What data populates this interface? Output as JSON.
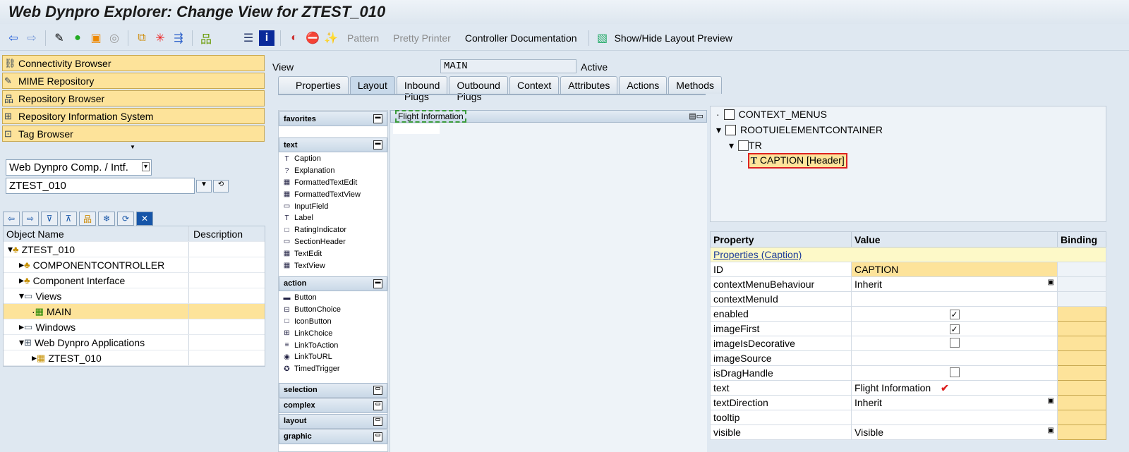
{
  "title": "Web Dynpro Explorer: Change View for ZTEST_010",
  "toolbar": {
    "pattern": "Pattern",
    "pretty_printer": "Pretty Printer",
    "controller_doc": "Controller Documentation",
    "show_hide": "Show/Hide Layout Preview"
  },
  "nav": [
    "Connectivity Browser",
    "MIME Repository",
    "Repository Browser",
    "Repository Information System",
    "Tag Browser"
  ],
  "object_type": "Web Dynpro Comp. / Intf.",
  "object_name": "ZTEST_010",
  "tree": {
    "col_name": "Object Name",
    "col_desc": "Description",
    "rows": [
      "ZTEST_010",
      "COMPONENTCONTROLLER",
      "Component Interface",
      "Views",
      "MAIN",
      "Windows",
      "Web Dynpro Applications",
      "ZTEST_010"
    ]
  },
  "view": {
    "label": "View",
    "name": "MAIN",
    "status": "Active"
  },
  "tabs": [
    "Properties",
    "Layout",
    "Inbound Plugs",
    "Outbound Plugs",
    "Context",
    "Attributes",
    "Actions",
    "Methods"
  ],
  "palette": {
    "favorites": "favorites",
    "text": "text",
    "text_items": [
      "Caption",
      "Explanation",
      "FormattedTextEdit",
      "FormattedTextView",
      "InputField",
      "Label",
      "RatingIndicator",
      "SectionHeader",
      "TextEdit",
      "TextView"
    ],
    "action": "action",
    "action_items": [
      "Button",
      "ButtonChoice",
      "IconButton",
      "LinkChoice",
      "LinkToAction",
      "LinkToURL",
      "TimedTrigger"
    ],
    "selection": "selection",
    "complex": "complex",
    "layout": "layout",
    "graphic": "graphic"
  },
  "canvas_caption": "Flight Information",
  "ui_tree": {
    "context_menus": "CONTEXT_MENUS",
    "root": "ROOTUIELEMENTCONTAINER",
    "tr": "TR",
    "caption": "CAPTION",
    "caption_role": "[Header]"
  },
  "props": {
    "h_property": "Property",
    "h_value": "Value",
    "h_binding": "Binding",
    "section": "Properties (Caption)",
    "rows": [
      {
        "p": "ID",
        "v": "CAPTION"
      },
      {
        "p": "contextMenuBehaviour",
        "v": "Inherit"
      },
      {
        "p": "contextMenuId",
        "v": ""
      },
      {
        "p": "enabled",
        "v": "✓"
      },
      {
        "p": "imageFirst",
        "v": "✓"
      },
      {
        "p": "imageIsDecorative",
        "v": ""
      },
      {
        "p": "imageSource",
        "v": ""
      },
      {
        "p": "isDragHandle",
        "v": ""
      },
      {
        "p": "text",
        "v": "Flight Information"
      },
      {
        "p": "textDirection",
        "v": "Inherit"
      },
      {
        "p": "tooltip",
        "v": ""
      },
      {
        "p": "visible",
        "v": "Visible"
      }
    ]
  }
}
